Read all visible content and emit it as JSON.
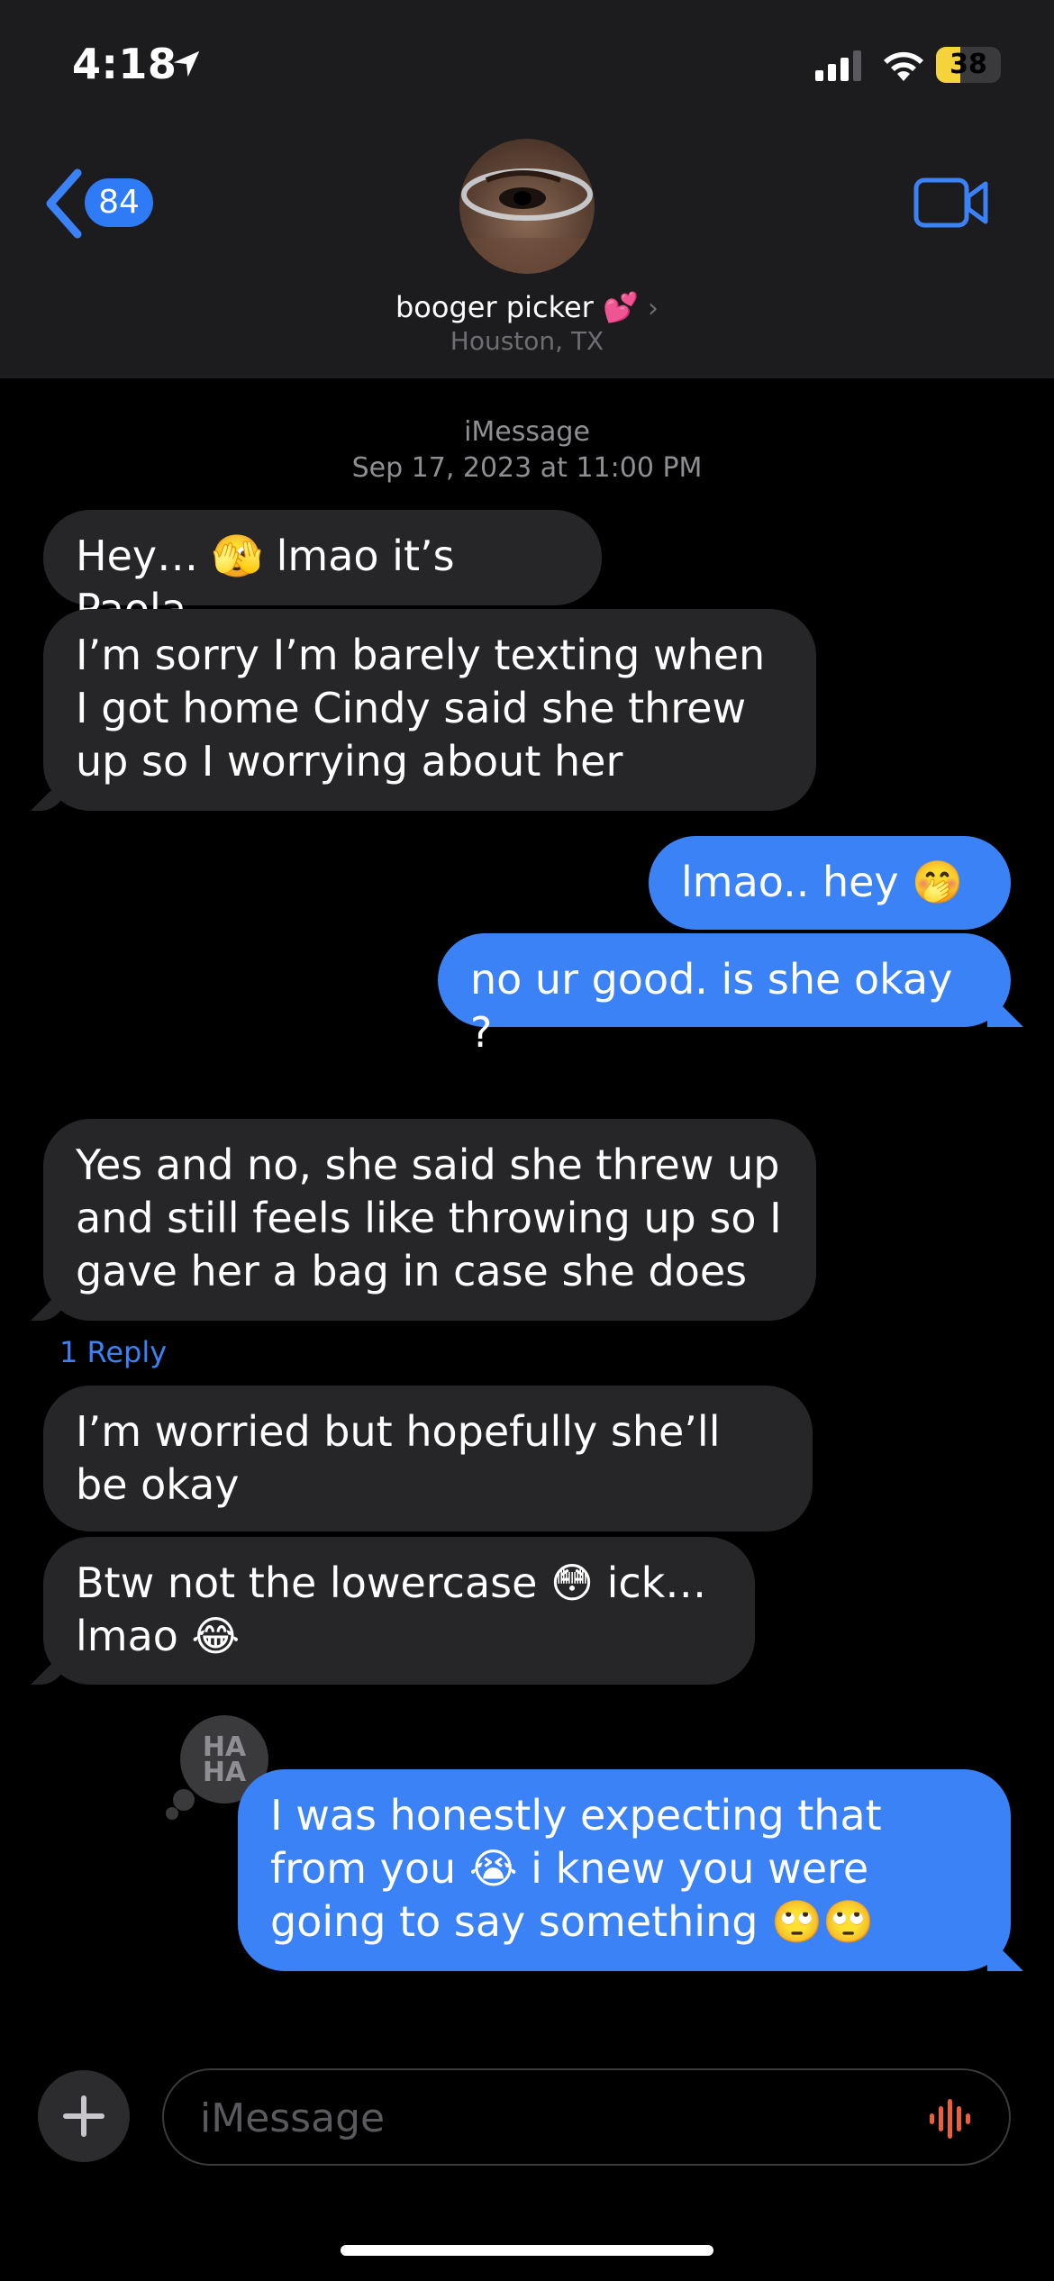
{
  "status_bar": {
    "time": "4:18",
    "battery_label": "38",
    "battery_level": 0.38,
    "battery_color": "#f5d33a"
  },
  "header": {
    "back_count": "84",
    "contact_name": "booger picker 💕",
    "contact_subtitle": "Houston, TX",
    "accent_color": "#3b82f6"
  },
  "conversation": {
    "service": "iMessage",
    "date": "Sep 17, 2023 at 11:00 PM",
    "messages": [
      {
        "side": "in",
        "text": "Hey… 🫣 lmao it’s Paola"
      },
      {
        "side": "in",
        "text": "I’m sorry I’m barely texting when I got home Cindy said she threw up so I worrying about her"
      },
      {
        "side": "out",
        "text": "lmao.. hey 🤭"
      },
      {
        "side": "out",
        "text": "no ur good. is she okay ?"
      },
      {
        "side": "in",
        "text": "Yes and no, she said she threw up and still feels like throwing up so I gave her a bag in case she does"
      },
      {
        "side": "in",
        "text": "I’m worried but hopefully she’ll be okay"
      },
      {
        "side": "in",
        "text": "Btw not the lowercase 😳 ick… lmao 😂"
      },
      {
        "side": "out",
        "text": "I was honestly expecting that from you 😭 i knew you were going to say something 🙄🙄"
      }
    ],
    "reply_link": "1 Reply",
    "tapback_line1": "HA",
    "tapback_line2": "HA"
  },
  "compose": {
    "placeholder": "iMessage",
    "plus_icon": "plus-icon",
    "mic_icon": "audio-waveform-icon"
  }
}
